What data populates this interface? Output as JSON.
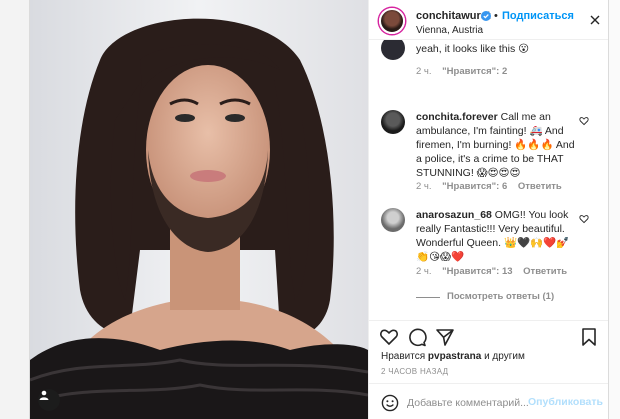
{
  "header": {
    "username": "conchitawurst",
    "dot": "•",
    "follow_label": "Подписаться",
    "location": "Vienna, Austria"
  },
  "comments": [
    {
      "username": "",
      "text": "yeah, it looks like this 😮",
      "time": "2 ч.",
      "likes": "\"Нравится\": 2"
    },
    {
      "username": "conchita.forever",
      "text": "Call me an ambulance, I'm fainting! 🚑 And firemen, I'm burning! 🔥🔥🔥 And a police, it's a crime to be THAT STUNNING! 😱😍😍😍",
      "time": "2 ч.",
      "likes": "\"Нравится\": 6",
      "reply_label": "Ответить"
    },
    {
      "username": "anarosazun_68",
      "text": "OMG!! You look really Fantastic!!! Very beautiful. Wonderful Queen. 👑🖤🙌❤️💅 👏😘😱❤️",
      "time": "2 ч.",
      "likes": "\"Нравится\": 13",
      "reply_label": "Ответить"
    }
  ],
  "view_replies": "Посмотреть ответы (1)",
  "likes_line": {
    "prefix": "Нравится",
    "user": "pvpastrana",
    "suffix": "и другим"
  },
  "time_ago": "2 ЧАСОВ НАЗАД",
  "add_comment": {
    "placeholder": "Добавьте комментарий...",
    "publish_label": "Опубликовать"
  },
  "colors": {
    "accent": "#0095f6",
    "muted": "#8e8e8e",
    "publish_disabled": "#b2dffc"
  },
  "icons": [
    "verified-icon",
    "more-icon",
    "heart-icon",
    "comment-icon",
    "share-icon",
    "bookmark-icon",
    "emoji-icon",
    "user-tag-icon"
  ]
}
